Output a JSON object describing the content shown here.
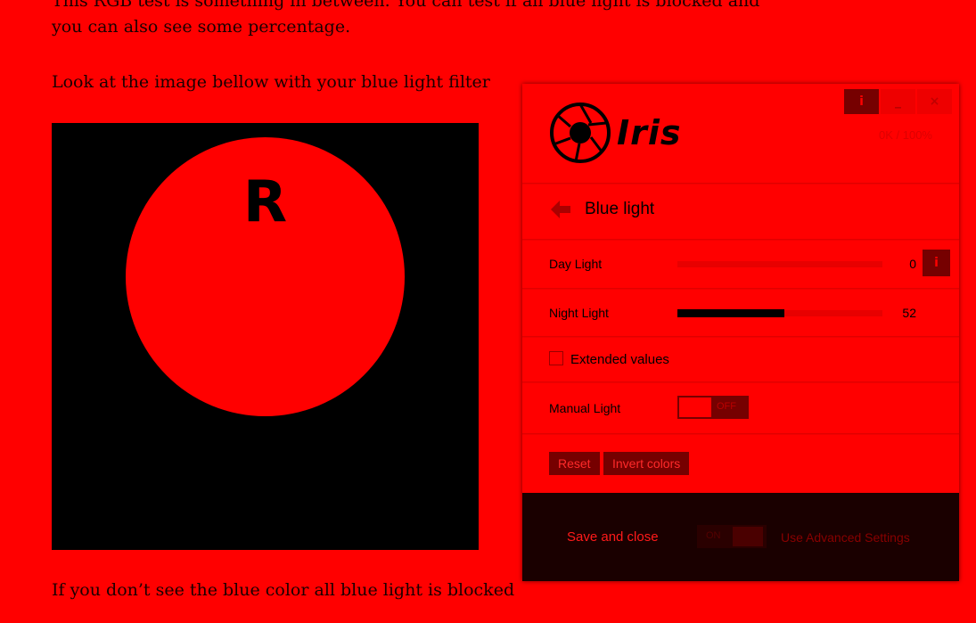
{
  "article": {
    "intro": "This RGB test is something in between. You can test if all blue light is blocked and you can also see some percentage.",
    "instruction": "Look at the image bellow with your blue light filter",
    "footnote": "If you don’t see the blue color all blue light is blocked"
  },
  "test_image": {
    "letter": "R"
  },
  "iris": {
    "logo_text": "Iris",
    "usage": "0K / 100%",
    "window_buttons": {
      "info": "i",
      "minimize": "_",
      "close": "×"
    },
    "section_title": "Blue light",
    "day_light": {
      "label": "Day Light",
      "value": "0",
      "fill_percent": 0
    },
    "night_light": {
      "label": "Night Light",
      "value": "52",
      "fill_percent": 52
    },
    "extended_values": {
      "label": "Extended values",
      "checked": false
    },
    "manual_light": {
      "label": "Manual Light",
      "state": "OFF"
    },
    "buttons": {
      "reset": "Reset",
      "invert": "Invert colors"
    },
    "footer": {
      "save_close": "Save and close",
      "advanced_state": "ON",
      "advanced_label": "Use Advanced Settings"
    }
  },
  "colors": {
    "background": "#ff0000",
    "dark_button": "#760000",
    "footer": "#1a0000"
  }
}
